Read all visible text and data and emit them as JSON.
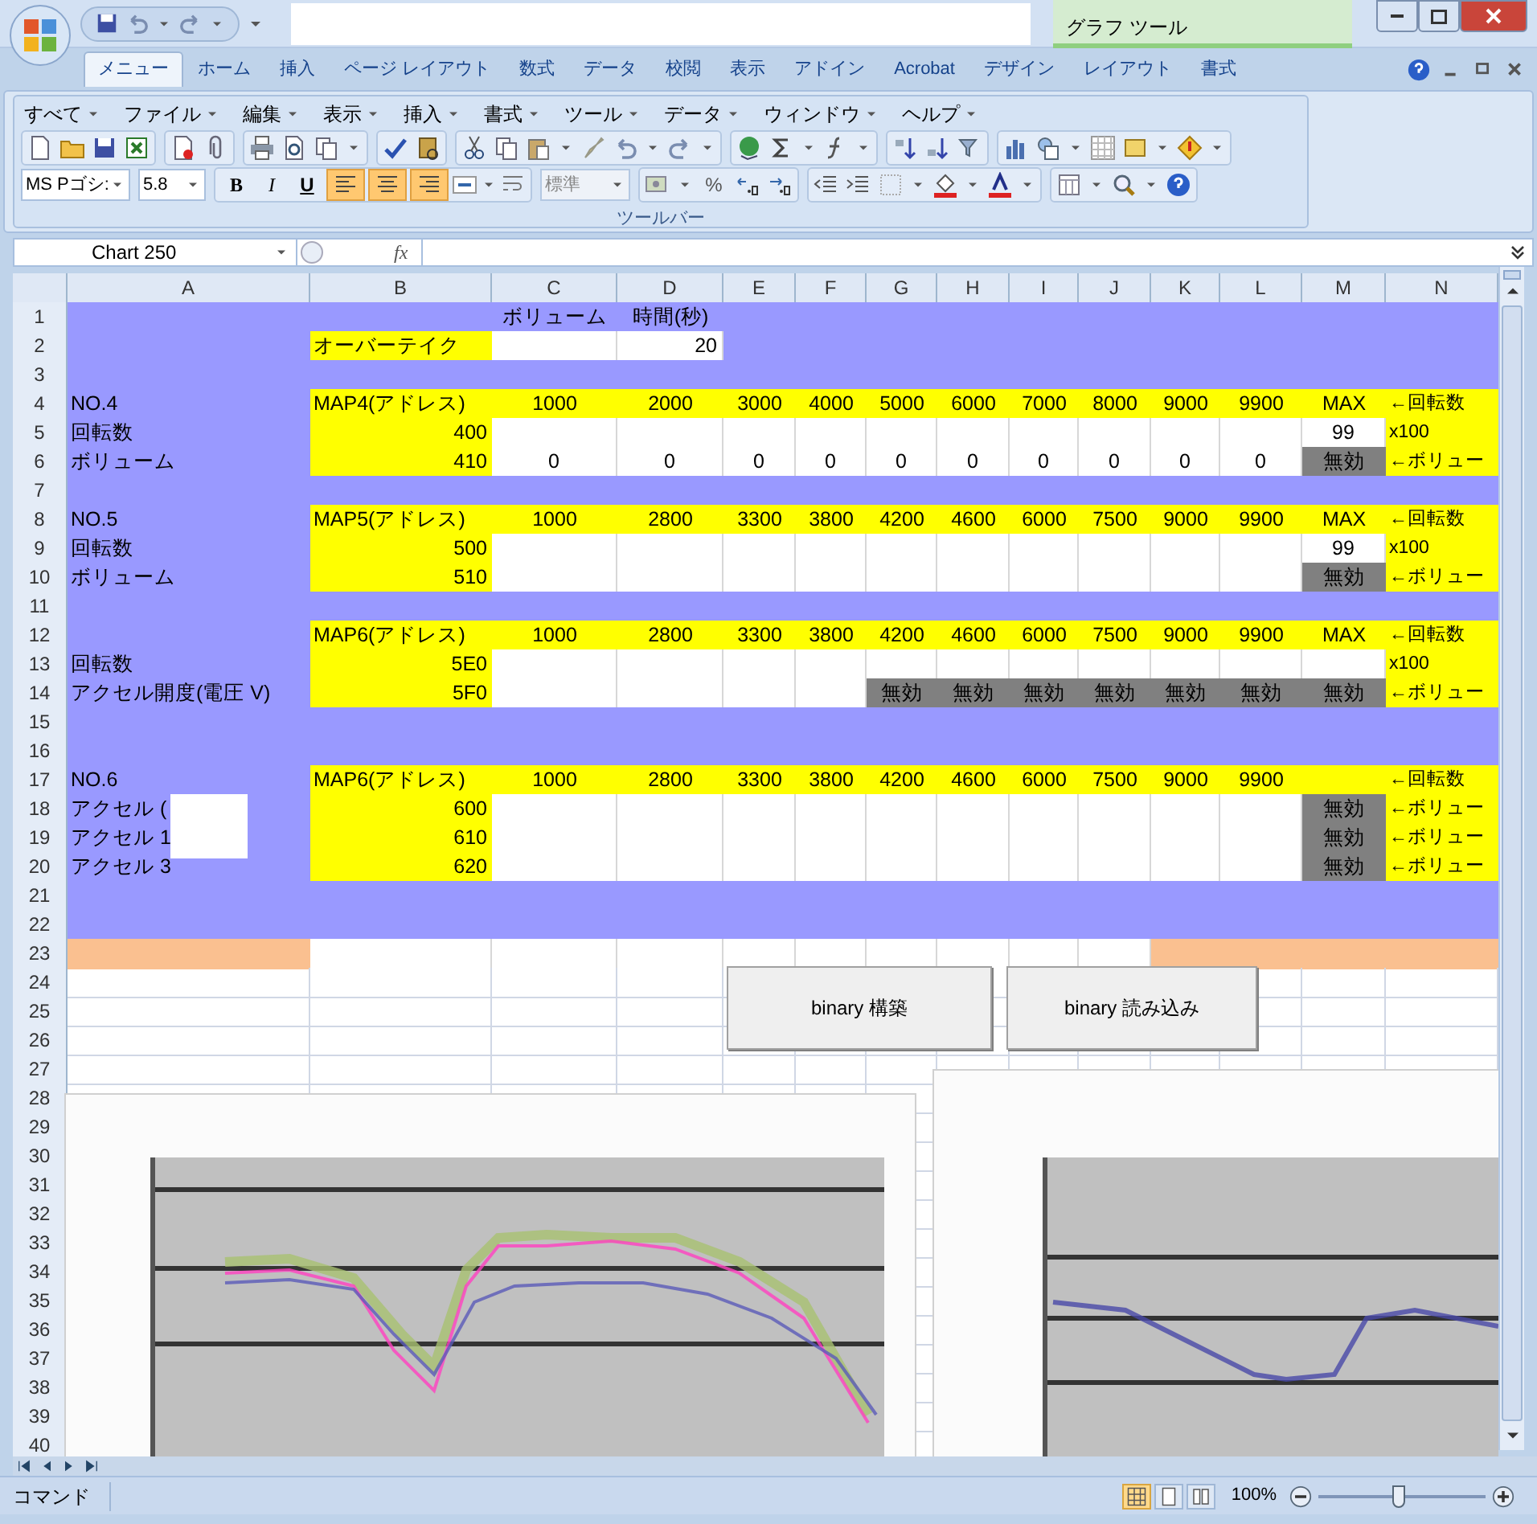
{
  "window": {
    "context_tab": "グラフ ツール"
  },
  "tabs": [
    {
      "label": "メニュー",
      "selected": true
    },
    {
      "label": "ホーム",
      "selected": false
    },
    {
      "label": "挿入",
      "selected": false
    },
    {
      "label": "ページ レイアウト",
      "selected": false
    },
    {
      "label": "数式",
      "selected": false
    },
    {
      "label": "データ",
      "selected": false
    },
    {
      "label": "校閲",
      "selected": false
    },
    {
      "label": "表示",
      "selected": false
    },
    {
      "label": "アドイン",
      "selected": false
    },
    {
      "label": "Acrobat",
      "selected": false
    },
    {
      "label": "デザイン",
      "selected": false
    },
    {
      "label": "レイアウト",
      "selected": false
    },
    {
      "label": "書式",
      "selected": false
    }
  ],
  "menu_bar": [
    "すべて",
    "ファイル",
    "編集",
    "表示",
    "挿入",
    "書式",
    "ツール",
    "データ",
    "ウィンドウ",
    "ヘルプ"
  ],
  "toolbar": {
    "font": "MS Pゴシ:",
    "size": "5.8",
    "style_buttons": [
      "B",
      "I",
      "U"
    ],
    "alignment_buttons": [
      {
        "pressed": true
      },
      {
        "pressed": true
      },
      {
        "pressed": true
      }
    ],
    "number_format": "標準",
    "percent": "%",
    "group_label": "ツールバー"
  },
  "formula_bar": {
    "name_box": "Chart 250",
    "function_label": "fx"
  },
  "columns": [
    "A",
    "B",
    "C",
    "D",
    "E",
    "F",
    "G",
    "H",
    "I",
    "J",
    "K",
    "L",
    "M",
    "N"
  ],
  "rows": [
    {
      "number": "1",
      "kind": "form",
      "cells": [
        {
          "kind": "blank"
        },
        {
          "kind": "blank"
        },
        {
          "kind": "label",
          "text": "ボリューム"
        },
        {
          "kind": "label",
          "text": "時間(秒)"
        }
      ]
    },
    {
      "number": "2",
      "kind": "setting",
      "cells": [
        {
          "kind": "blank"
        },
        {
          "kind": "yellow",
          "text": "オーバーテイク"
        },
        {
          "kind": "white"
        },
        {
          "kind": "white",
          "text": "20"
        }
      ]
    },
    {
      "number": "3",
      "kind": "form"
    },
    {
      "number": "4",
      "kind": "header",
      "cells": [
        {
          "kind": "label",
          "text": "NO.4"
        },
        {
          "kind": "yellow",
          "text": "MAP4(アドレス)"
        },
        {
          "kind": "yellow",
          "text": "1000"
        },
        {
          "kind": "yellow",
          "text": "2000"
        },
        {
          "kind": "yellow",
          "text": "3000"
        },
        {
          "kind": "yellow",
          "text": "4000"
        },
        {
          "kind": "yellow",
          "text": "5000"
        },
        {
          "kind": "yellow",
          "text": "6000"
        },
        {
          "kind": "yellow",
          "text": "7000"
        },
        {
          "kind": "yellow",
          "text": "8000"
        },
        {
          "kind": "yellow",
          "text": "9000"
        },
        {
          "kind": "yellow",
          "text": "9900"
        },
        {
          "kind": "yellow",
          "text": "MAX"
        },
        {
          "kind": "yellow",
          "text": "←回転数"
        }
      ]
    },
    {
      "number": "5",
      "kind": "data",
      "cells": [
        {
          "kind": "label",
          "text": "回転数"
        },
        {
          "kind": "yellow",
          "text": "400"
        },
        {
          "kind": "white"
        },
        {
          "kind": "white"
        },
        {
          "kind": "white"
        },
        {
          "kind": "white"
        },
        {
          "kind": "white"
        },
        {
          "kind": "white"
        },
        {
          "kind": "white"
        },
        {
          "kind": "white"
        },
        {
          "kind": "white"
        },
        {
          "kind": "white"
        },
        {
          "kind": "white",
          "text": "99"
        },
        {
          "kind": "yellow",
          "text": "x100"
        }
      ]
    },
    {
      "number": "6",
      "kind": "data",
      "cells": [
        {
          "kind": "label",
          "text": "ボリューム"
        },
        {
          "kind": "yellow",
          "text": "410"
        },
        {
          "kind": "white",
          "text": "0"
        },
        {
          "kind": "white",
          "text": "0"
        },
        {
          "kind": "white",
          "text": "0"
        },
        {
          "kind": "white",
          "text": "0"
        },
        {
          "kind": "white",
          "text": "0"
        },
        {
          "kind": "white",
          "text": "0"
        },
        {
          "kind": "white",
          "text": "0"
        },
        {
          "kind": "white",
          "text": "0"
        },
        {
          "kind": "white",
          "text": "0"
        },
        {
          "kind": "white",
          "text": "0"
        },
        {
          "kind": "disabled",
          "text": "無効"
        },
        {
          "kind": "yellow",
          "text": "←ボリュー"
        }
      ]
    },
    {
      "number": "7",
      "kind": "form"
    },
    {
      "number": "8",
      "kind": "header",
      "cells": [
        {
          "kind": "label",
          "text": "NO.5"
        },
        {
          "kind": "yellow",
          "text": "MAP5(アドレス)"
        },
        {
          "kind": "yellow",
          "text": "1000"
        },
        {
          "kind": "yellow",
          "text": "2800"
        },
        {
          "kind": "yellow",
          "text": "3300"
        },
        {
          "kind": "yellow",
          "text": "3800"
        },
        {
          "kind": "yellow",
          "text": "4200"
        },
        {
          "kind": "yellow",
          "text": "4600"
        },
        {
          "kind": "yellow",
          "text": "6000"
        },
        {
          "kind": "yellow",
          "text": "7500"
        },
        {
          "kind": "yellow",
          "text": "9000"
        },
        {
          "kind": "yellow",
          "text": "9900"
        },
        {
          "kind": "yellow",
          "text": "MAX"
        },
        {
          "kind": "yellow",
          "text": "←回転数"
        }
      ]
    },
    {
      "number": "9",
      "kind": "data",
      "cells": [
        {
          "kind": "label",
          "text": "回転数"
        },
        {
          "kind": "yellow",
          "text": "500"
        },
        {
          "kind": "white"
        },
        {
          "kind": "white"
        },
        {
          "kind": "white"
        },
        {
          "kind": "white"
        },
        {
          "kind": "white"
        },
        {
          "kind": "white"
        },
        {
          "kind": "white"
        },
        {
          "kind": "white"
        },
        {
          "kind": "white"
        },
        {
          "kind": "white"
        },
        {
          "kind": "white",
          "text": "99"
        },
        {
          "kind": "yellow",
          "text": "x100"
        }
      ]
    },
    {
      "number": "10",
      "kind": "data",
      "cells": [
        {
          "kind": "label",
          "text": "ボリューム"
        },
        {
          "kind": "yellow",
          "text": "510"
        },
        {
          "kind": "white"
        },
        {
          "kind": "white"
        },
        {
          "kind": "white"
        },
        {
          "kind": "white"
        },
        {
          "kind": "white"
        },
        {
          "kind": "white"
        },
        {
          "kind": "white"
        },
        {
          "kind": "white"
        },
        {
          "kind": "white"
        },
        {
          "kind": "white"
        },
        {
          "kind": "disabled",
          "text": "無効"
        },
        {
          "kind": "yellow",
          "text": "←ボリュー"
        }
      ]
    },
    {
      "number": "11",
      "kind": "form"
    },
    {
      "number": "12",
      "kind": "header",
      "cells": [
        {
          "kind": "blank"
        },
        {
          "kind": "yellow",
          "text": "MAP6(アドレス)"
        },
        {
          "kind": "yellow",
          "text": "1000"
        },
        {
          "kind": "yellow",
          "text": "2800"
        },
        {
          "kind": "yellow",
          "text": "3300"
        },
        {
          "kind": "yellow",
          "text": "3800"
        },
        {
          "kind": "yellow",
          "text": "4200"
        },
        {
          "kind": "yellow",
          "text": "4600"
        },
        {
          "kind": "yellow",
          "text": "6000"
        },
        {
          "kind": "yellow",
          "text": "7500"
        },
        {
          "kind": "yellow",
          "text": "9000"
        },
        {
          "kind": "yellow",
          "text": "9900"
        },
        {
          "kind": "yellow",
          "text": "MAX"
        },
        {
          "kind": "yellow",
          "text": "←回転数"
        }
      ]
    },
    {
      "number": "13",
      "kind": "data",
      "cells": [
        {
          "kind": "label",
          "text": "回転数"
        },
        {
          "kind": "yellow",
          "text": "5E0"
        },
        {
          "kind": "white"
        },
        {
          "kind": "white"
        },
        {
          "kind": "white"
        },
        {
          "kind": "white"
        },
        {
          "kind": "white"
        },
        {
          "kind": "white"
        },
        {
          "kind": "white"
        },
        {
          "kind": "white"
        },
        {
          "kind": "white"
        },
        {
          "kind": "white"
        },
        {
          "kind": "white"
        },
        {
          "kind": "yellow",
          "text": "x100"
        }
      ]
    },
    {
      "number": "14",
      "kind": "data",
      "cells": [
        {
          "kind": "label",
          "text": "アクセル開度(電圧 V)"
        },
        {
          "kind": "yellow",
          "text": "5F0"
        },
        {
          "kind": "white"
        },
        {
          "kind": "white"
        },
        {
          "kind": "white"
        },
        {
          "kind": "white"
        },
        {
          "kind": "disabled",
          "text": "無効"
        },
        {
          "kind": "disabled",
          "text": "無効"
        },
        {
          "kind": "disabled",
          "text": "無効"
        },
        {
          "kind": "disabled",
          "text": "無効"
        },
        {
          "kind": "disabled",
          "text": "無効"
        },
        {
          "kind": "disabled",
          "text": "無効"
        },
        {
          "kind": "disabled",
          "text": "無効"
        },
        {
          "kind": "yellow",
          "text": "←ボリュー"
        }
      ]
    },
    {
      "number": "15",
      "kind": "form"
    },
    {
      "number": "16",
      "kind": "form"
    },
    {
      "number": "17",
      "kind": "header",
      "cells": [
        {
          "kind": "label",
          "text": "NO.6"
        },
        {
          "kind": "yellow",
          "text": "MAP6(アドレス)"
        },
        {
          "kind": "yellow",
          "text": "1000"
        },
        {
          "kind": "yellow",
          "text": "2800"
        },
        {
          "kind": "yellow",
          "text": "3300"
        },
        {
          "kind": "yellow",
          "text": "3800"
        },
        {
          "kind": "yellow",
          "text": "4200"
        },
        {
          "kind": "yellow",
          "text": "4600"
        },
        {
          "kind": "yellow",
          "text": "6000"
        },
        {
          "kind": "yellow",
          "text": "7500"
        },
        {
          "kind": "yellow",
          "text": "9000"
        },
        {
          "kind": "yellow",
          "text": "9900"
        },
        {
          "kind": "yellow"
        },
        {
          "kind": "yellow",
          "text": "←回転数"
        }
      ]
    },
    {
      "number": "18",
      "kind": "data",
      "cells": [
        {
          "kind": "label",
          "text": "アクセル (",
          "masked": true
        },
        {
          "kind": "yellow",
          "text": "600"
        },
        {
          "kind": "white"
        },
        {
          "kind": "white"
        },
        {
          "kind": "white"
        },
        {
          "kind": "white"
        },
        {
          "kind": "white"
        },
        {
          "kind": "white"
        },
        {
          "kind": "white"
        },
        {
          "kind": "white"
        },
        {
          "kind": "white"
        },
        {
          "kind": "white"
        },
        {
          "kind": "disabled",
          "text": "無効"
        },
        {
          "kind": "yellow",
          "text": "←ボリュー"
        }
      ]
    },
    {
      "number": "19",
      "kind": "data",
      "cells": [
        {
          "kind": "label",
          "text": "アクセル 1"
        },
        {
          "kind": "yellow",
          "text": "610"
        },
        {
          "kind": "white"
        },
        {
          "kind": "white"
        },
        {
          "kind": "white"
        },
        {
          "kind": "white"
        },
        {
          "kind": "white"
        },
        {
          "kind": "white"
        },
        {
          "kind": "white"
        },
        {
          "kind": "white"
        },
        {
          "kind": "white"
        },
        {
          "kind": "white"
        },
        {
          "kind": "disabled",
          "text": "無効"
        },
        {
          "kind": "yellow",
          "text": "←ボリュー"
        }
      ]
    },
    {
      "number": "20",
      "kind": "data",
      "cells": [
        {
          "kind": "label",
          "text": "アクセル 3"
        },
        {
          "kind": "yellow",
          "text": "620"
        },
        {
          "kind": "white"
        },
        {
          "kind": "white"
        },
        {
          "kind": "white"
        },
        {
          "kind": "white"
        },
        {
          "kind": "white"
        },
        {
          "kind": "white"
        },
        {
          "kind": "white"
        },
        {
          "kind": "white"
        },
        {
          "kind": "white"
        },
        {
          "kind": "white"
        },
        {
          "kind": "disabled",
          "text": "無効"
        },
        {
          "kind": "yellow",
          "text": "←ボリュー"
        }
      ]
    },
    {
      "number": "21",
      "kind": "form"
    },
    {
      "number": "22",
      "kind": "form"
    },
    {
      "number": "23",
      "kind": "form",
      "cells": [
        {
          "kind": "orange"
        },
        {
          "kind": "white"
        },
        {
          "kind": "white"
        },
        {
          "kind": "white"
        },
        {
          "kind": "white"
        },
        {
          "kind": "white"
        },
        {
          "kind": "white"
        },
        {
          "kind": "white"
        },
        {
          "kind": "white"
        },
        {
          "kind": "white"
        },
        {
          "kind": "orange"
        },
        {
          "kind": "orange"
        },
        {
          "kind": "orange"
        },
        {
          "kind": "orange"
        }
      ]
    },
    {
      "number": "24",
      "kind": "sheet"
    },
    {
      "number": "25",
      "kind": "sheet"
    },
    {
      "number": "26",
      "kind": "sheet"
    },
    {
      "number": "27",
      "kind": "sheet"
    },
    {
      "number": "28",
      "kind": "sheet"
    },
    {
      "number": "29",
      "kind": "sheet"
    },
    {
      "number": "30",
      "kind": "sheet"
    },
    {
      "number": "31",
      "kind": "sheet"
    },
    {
      "number": "32",
      "kind": "sheet"
    },
    {
      "number": "33",
      "kind": "sheet"
    },
    {
      "number": "34",
      "kind": "sheet"
    },
    {
      "number": "35",
      "kind": "sheet"
    },
    {
      "number": "36",
      "kind": "sheet"
    },
    {
      "number": "37",
      "kind": "sheet"
    },
    {
      "number": "38",
      "kind": "sheet"
    },
    {
      "number": "39",
      "kind": "sheet"
    },
    {
      "number": "40",
      "kind": "sheet"
    }
  ],
  "buttons": [
    {
      "label": "binary 構築"
    },
    {
      "label": "binary 読み込み"
    }
  ],
  "status_bar": {
    "mode": "コマンド",
    "view_buttons": [
      {
        "selected": true
      },
      {
        "selected": false
      },
      {
        "selected": false
      }
    ],
    "zoom": "100%",
    "zoom_slider": {
      "level": 0.48
    }
  }
}
